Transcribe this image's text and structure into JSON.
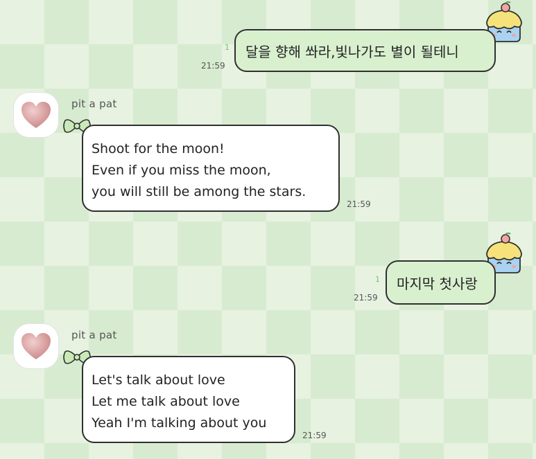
{
  "colors": {
    "bg_light": "#e7f2e1",
    "bg_dark": "#d7ebd0",
    "outgoing_bubble": "#d9f0cf",
    "incoming_bubble": "#ffffff",
    "bubble_border": "#2f2f2f",
    "unread_count": "#7fbf73"
  },
  "messages": [
    {
      "direction": "outgoing",
      "unread": "1",
      "time": "21:59",
      "lines": [
        "달을 향해 쏴라,빛나가도 별이 될테니"
      ]
    },
    {
      "direction": "incoming",
      "sender": "pit a pat",
      "time": "21:59",
      "avatar_icon": "heart-icon",
      "lines": [
        "Shoot for the moon!",
        "Even if you miss the moon,",
        "you will still be among the stars."
      ]
    },
    {
      "direction": "outgoing",
      "unread": "1",
      "time": "21:59",
      "lines": [
        "마지막 첫사랑"
      ]
    },
    {
      "direction": "incoming",
      "sender": "pit a pat",
      "time": "21:59",
      "avatar_icon": "heart-icon",
      "lines": [
        "Let's talk about love",
        "Let me talk about love",
        "Yeah I'm talking about you"
      ]
    }
  ]
}
